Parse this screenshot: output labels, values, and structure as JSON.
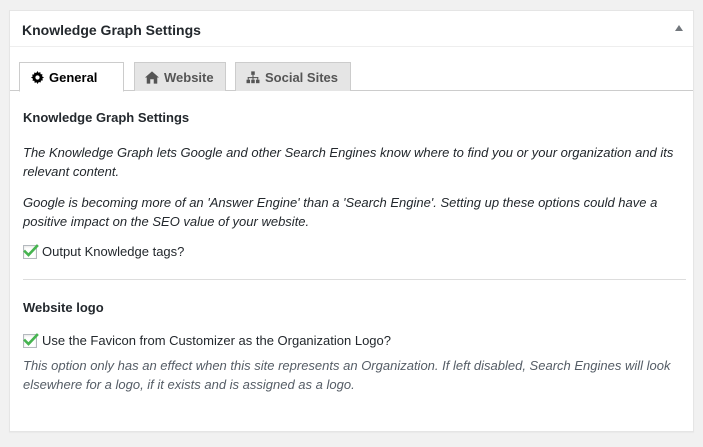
{
  "metabox": {
    "title": "Knowledge Graph Settings"
  },
  "tabs": [
    {
      "label": "General",
      "icon": "gear-icon",
      "active": true
    },
    {
      "label": "Website",
      "icon": "home-icon",
      "active": false
    },
    {
      "label": "Social Sites",
      "icon": "sitemap-icon",
      "active": false
    }
  ],
  "knowledge": {
    "heading": "Knowledge Graph Settings",
    "desc1": "The Knowledge Graph lets Google and other Search Engines know where to find you or your organization and its relevant content.",
    "desc2": "Google is becoming more of an 'Answer Engine' than a 'Search Engine'. Setting up these options could have a positive impact on the SEO value of your website.",
    "output_tags_label": "Output Knowledge tags?",
    "output_tags_checked": true
  },
  "logo": {
    "heading": "Website logo",
    "favicon_label": "Use the Favicon from Customizer as the Organization Logo?",
    "favicon_checked": true,
    "note": "This option only has an effect when this site represents an Organization. If left disabled, Search Engines will look elsewhere for a logo, if it exists and is assigned as a logo."
  },
  "colors": {
    "check": "#1e8cbe",
    "check_green": "#46b450"
  }
}
